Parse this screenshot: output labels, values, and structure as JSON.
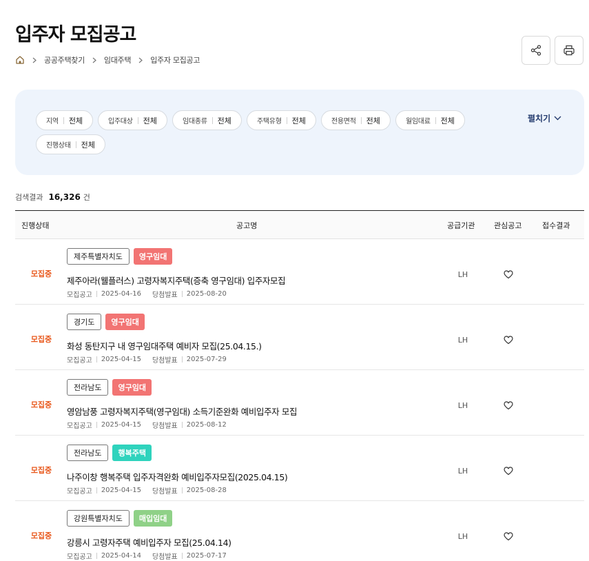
{
  "page": {
    "title": "입주자 모집공고"
  },
  "breadcrumb": {
    "home_icon": "home-icon",
    "items": [
      "공공주택찾기",
      "임대주택",
      "입주자 모집공고"
    ]
  },
  "toolbar": {
    "share_icon": "share-icon",
    "print_icon": "print-icon"
  },
  "filters": {
    "chips": [
      {
        "label": "지역",
        "value": "전체"
      },
      {
        "label": "입주대상",
        "value": "전체"
      },
      {
        "label": "임대종류",
        "value": "전체"
      },
      {
        "label": "주택유형",
        "value": "전체"
      },
      {
        "label": "전용면적",
        "value": "전체"
      },
      {
        "label": "월임대료",
        "value": "전체"
      },
      {
        "label": "진행상태",
        "value": "전체"
      }
    ],
    "expand_label": "펼치기"
  },
  "results": {
    "label": "검색결과",
    "count": "16,326",
    "unit": "건"
  },
  "table": {
    "headers": {
      "status": "진행상태",
      "title": "공고명",
      "org": "공급기관",
      "interest": "관심공고",
      "result": "접수결과"
    },
    "rows": [
      {
        "status": "모집중",
        "region": "제주특별자치도",
        "type": "영구임대",
        "title": "제주아라(웰플러스) 고령자복지주택(증축 영구임대) 입주자모집",
        "notice_label": "모집공고",
        "notice_date": "2025-04-16",
        "announce_label": "당첨발표",
        "announce_date": "2025-08-20",
        "org": "LH"
      },
      {
        "status": "모집중",
        "region": "경기도",
        "type": "영구임대",
        "title": "화성 동탄지구 내 영구임대주택 예비자 모집(25.04.15.)",
        "notice_label": "모집공고",
        "notice_date": "2025-04-15",
        "announce_label": "당첨발표",
        "announce_date": "2025-07-29",
        "org": "LH"
      },
      {
        "status": "모집중",
        "region": "전라남도",
        "type": "영구임대",
        "title": "영암남풍 고령자복지주택(영구임대) 소득기준완화 예비입주자 모집",
        "notice_label": "모집공고",
        "notice_date": "2025-04-15",
        "announce_label": "당첨발표",
        "announce_date": "2025-08-12",
        "org": "LH"
      },
      {
        "status": "모집중",
        "region": "전라남도",
        "type": "행복주택",
        "title": "나주이창 행복주택 입주자격완화 예비입주자모집(2025.04.15)",
        "notice_label": "모집공고",
        "notice_date": "2025-04-15",
        "announce_label": "당첨발표",
        "announce_date": "2025-08-28",
        "org": "LH"
      },
      {
        "status": "모집중",
        "region": "강원특별자치도",
        "type": "매입임대",
        "title": "강릉시 고령자주택 예비입주자 모집(25.04.14)",
        "notice_label": "모집공고",
        "notice_date": "2025-04-14",
        "announce_label": "당첨발표",
        "announce_date": "2025-07-17",
        "org": "LH"
      }
    ]
  },
  "colors": {
    "status": "#e8581c",
    "type_영구임대": "#f27473",
    "type_행복주택": "#2fd3bd",
    "type_매입임대": "#8fd187",
    "filter_bg": "#eef4fc"
  }
}
